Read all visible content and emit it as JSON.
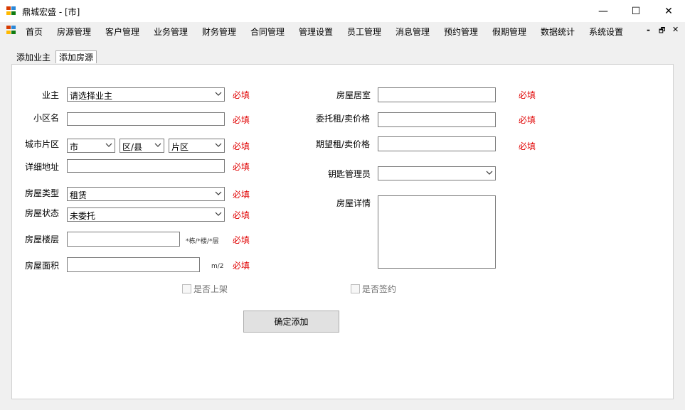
{
  "window": {
    "title": "鼎城宏盛 - [市]",
    "minimize": "—",
    "maximize": "☐",
    "close": "✕"
  },
  "menu": {
    "items": [
      "首页",
      "房源管理",
      "客户管理",
      "业务管理",
      "财务管理",
      "合同管理",
      "管理设置",
      "员工管理",
      "消息管理",
      "预约管理",
      "假期管理",
      "数据统计",
      "系统设置"
    ],
    "mdi_min": "-",
    "mdi_restore": "🗗",
    "mdi_close": "✕"
  },
  "tabs": [
    "添加业主",
    "添加房源"
  ],
  "form": {
    "owner_label": "业主",
    "owner_value": "请选择业主",
    "community_label": "小区名",
    "city_label": "城市片区",
    "city_value": "市",
    "district_value": "区/县",
    "area_value": "片区",
    "address_label": "详细地址",
    "type_label": "房屋类型",
    "type_value": "租赁",
    "status_label": "房屋状态",
    "status_value": "未委托",
    "floor_label": "房屋楼层",
    "floor_hint": "*栋/*楼/*层",
    "size_label": "房屋面积",
    "size_unit": "m/2",
    "rooms_label": "房屋居室",
    "entrust_label": "委托租/卖价格",
    "expect_label": "期望租/卖价格",
    "key_label": "钥匙管理员",
    "detail_label": "房屋详情",
    "required": "必填",
    "listed_label": "是否上架",
    "signed_label": "是否签约",
    "submit_label": "确定添加"
  }
}
